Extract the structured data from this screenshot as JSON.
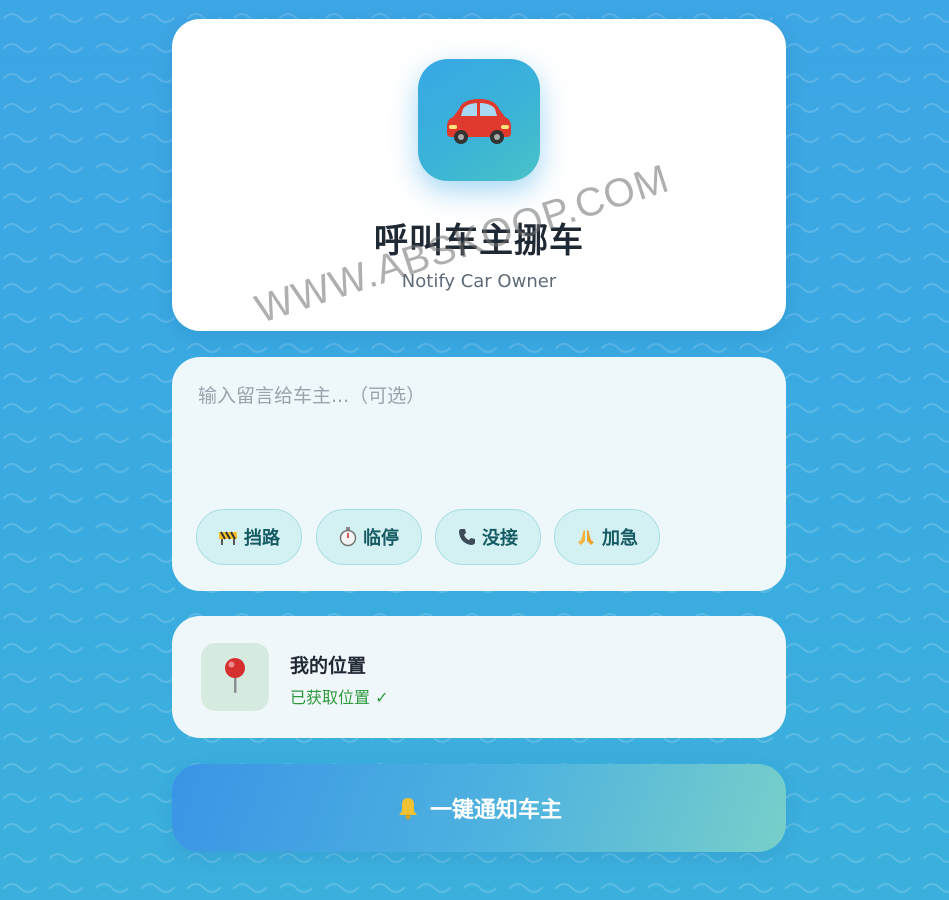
{
  "header": {
    "app_icon": "red-car-icon",
    "title": "呼叫车主挪车",
    "subtitle": "Notify Car Owner"
  },
  "message": {
    "placeholder": "输入留言给车主...（可选）",
    "value": ""
  },
  "quick_replies": [
    {
      "icon": "construction-barrier-icon",
      "label": "挡路"
    },
    {
      "icon": "stopwatch-icon",
      "label": "临停"
    },
    {
      "icon": "telephone-icon",
      "label": "没接"
    },
    {
      "icon": "praying-hands-icon",
      "label": "加急"
    }
  ],
  "location": {
    "icon": "pushpin-icon",
    "title": "我的位置",
    "status": "已获取位置 ✓"
  },
  "notify_button": {
    "icon": "bell-icon",
    "label": "一键通知车主"
  },
  "watermark": "WWW.ABSKOOP.COM",
  "colors": {
    "background": "#3da6e4",
    "chip_bg": "#d3f1f3",
    "chip_text": "#165a63",
    "status_green": "#2e9a3c",
    "button_start": "#3a94e6",
    "button_end": "#78cfc9"
  }
}
